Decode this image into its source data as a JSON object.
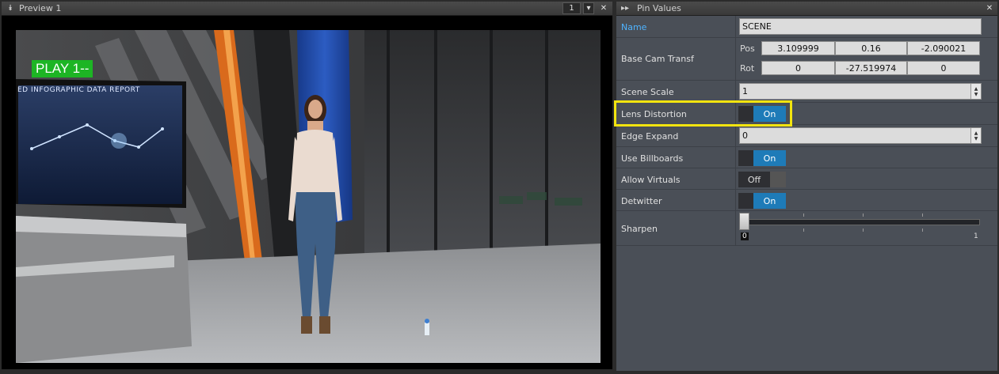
{
  "preview": {
    "title": "Preview 1",
    "view_number": "1",
    "play_indicator": "PLAY 1--",
    "screen_title": "ED INFOGRAPHIC DATA REPORT"
  },
  "pin_values": {
    "title": "Pin Values",
    "rows": {
      "name": {
        "label": "Name",
        "value": "SCENE"
      },
      "base_cam": {
        "label": "Base Cam Transf",
        "pos_label": "Pos",
        "pos": [
          "3.109999",
          "0.16",
          "-2.090021"
        ],
        "rot_label": "Rot",
        "rot": [
          "0",
          "-27.519974",
          "0"
        ]
      },
      "scene_scale": {
        "label": "Scene Scale",
        "value": "1"
      },
      "lens_distortion": {
        "label": "Lens Distortion",
        "state": "On"
      },
      "edge_expand": {
        "label": "Edge Expand",
        "value": "0"
      },
      "use_billboards": {
        "label": "Use Billboards",
        "state": "On"
      },
      "allow_virtuals": {
        "label": "Allow Virtuals",
        "state": "Off"
      },
      "detwitter": {
        "label": "Detwitter",
        "state": "On"
      },
      "sharpen": {
        "label": "Sharpen",
        "value": 0,
        "min": "0",
        "max": "1",
        "value_label": "0"
      }
    }
  },
  "colors": {
    "accent": "#1e7bb8",
    "highlight": "#f2e40f",
    "play_green": "#1db524"
  },
  "icons": [
    "collapse-icon",
    "dropdown-arrow-icon",
    "close-icon",
    "double-arrow-icon",
    "spin-arrows-icon"
  ]
}
